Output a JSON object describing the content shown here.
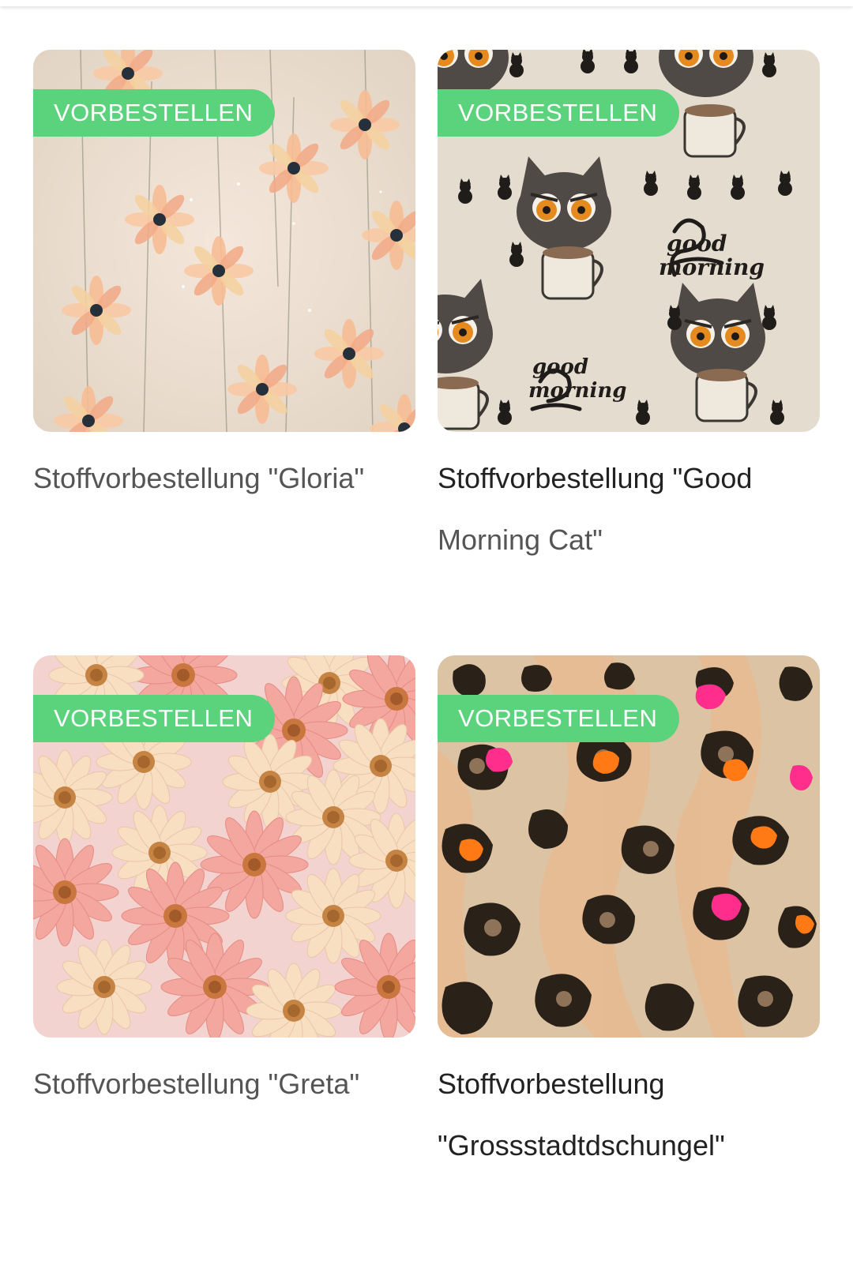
{
  "products": [
    {
      "badge": "VORBESTELLEN",
      "title_line1": "Stoffvorbestellung \"Gloria\"",
      "title_line2": "",
      "pattern": "pastel-flowers",
      "image_palette": {
        "bg": "#efe1d4",
        "petal": "#f3b18a",
        "center": "#26303b"
      }
    },
    {
      "badge": "VORBESTELLEN",
      "title_line1": "Stoffvorbestellung \"Good",
      "title_line2": "Morning Cat\"",
      "pattern": "grumpy-cats-coffee",
      "image_palette": {
        "bg": "#e4ddcf",
        "cat": "#4f4a46",
        "eye": "#e48a1f"
      }
    },
    {
      "badge": "VORBESTELLEN",
      "title_line1": "Stoffvorbestellung \"Greta\"",
      "title_line2": "",
      "pattern": "pink-daisies",
      "image_palette": {
        "bg": "#f3d3cf",
        "petal1": "#f8dfc2",
        "petal2": "#f3a79e",
        "center": "#c58443"
      }
    },
    {
      "badge": "VORBESTELLEN",
      "title_line1": "Stoffvorbestellung",
      "title_line2": "\"Grossstadtdschungel\"",
      "pattern": "leopard-print",
      "image_palette": {
        "bg": "#dcc3a3",
        "spot": "#2a2119",
        "pink": "#ff2e8c",
        "orange": "#ff7a14"
      }
    }
  ],
  "colors": {
    "badge": "#5bd37c",
    "text": "#555555"
  }
}
